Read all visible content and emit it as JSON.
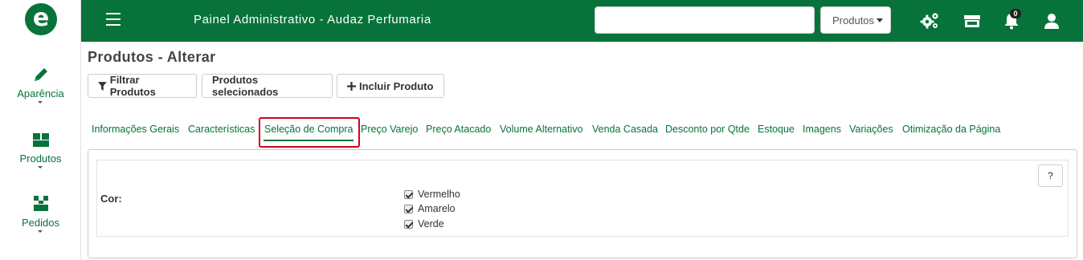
{
  "sidebar": {
    "logo_letter": "e",
    "items": [
      {
        "label": "Aparência",
        "icon": "pencil-icon"
      },
      {
        "label": "Produtos",
        "icon": "boxes-icon"
      },
      {
        "label": "Pedidos",
        "icon": "network-icon"
      }
    ]
  },
  "header": {
    "title": "Painel Administrativo - Audaz Perfumaria",
    "search_value": "",
    "search_select": "Produtos",
    "notification_count": "0",
    "icons": [
      "settings-cogs-icon",
      "store-icon",
      "bell-icon",
      "user-icon"
    ]
  },
  "page": {
    "title": "Produtos - Alterar"
  },
  "toolbar": {
    "filter_label": "Filtrar Produtos",
    "selected_label": "Produtos selecionados",
    "add_label": "Incluir Produto"
  },
  "tabs": [
    "Informações Gerais",
    "Características",
    "Seleção de Compra",
    "Preço Varejo",
    "Preço Atacado",
    "Volume Alternativo",
    "Venda Casada",
    "Desconto por Qtde",
    "Estoque",
    "Imagens",
    "Variações",
    "Otimização da Página"
  ],
  "active_tab": "Seleção de Compra",
  "form": {
    "field_label": "Cor:",
    "help_label": "?",
    "options": [
      {
        "label": "Vermelho",
        "checked": true
      },
      {
        "label": "Amarelo",
        "checked": true
      },
      {
        "label": "Verde",
        "checked": true
      }
    ]
  },
  "colors": {
    "brand": "#07733a",
    "highlight": "#d0021b"
  }
}
